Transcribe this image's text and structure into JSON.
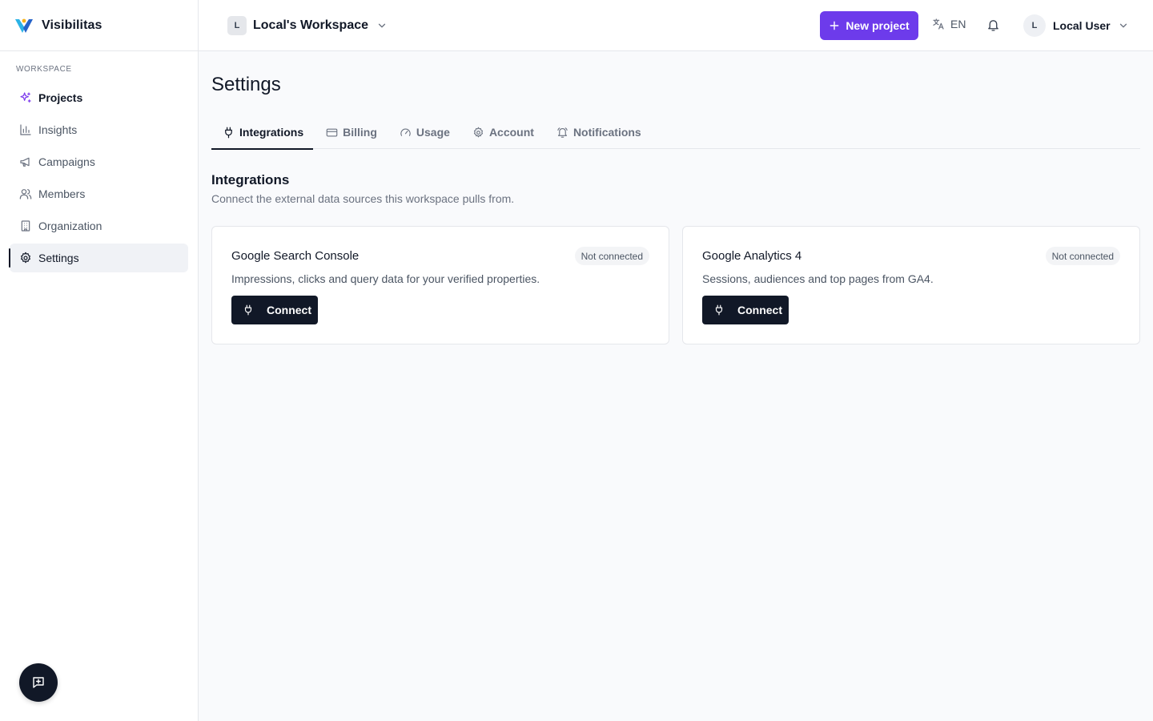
{
  "brand": {
    "name": "Visibilitas"
  },
  "sidebar": {
    "section_label": "WORKSPACE",
    "items": [
      {
        "label": "Projects",
        "icon": "sparkles-icon"
      },
      {
        "label": "Insights",
        "icon": "bar-chart-icon"
      },
      {
        "label": "Campaigns",
        "icon": "megaphone-icon"
      },
      {
        "label": "Members",
        "icon": "users-icon"
      },
      {
        "label": "Organization",
        "icon": "building-icon"
      },
      {
        "label": "Settings",
        "icon": "gear-icon",
        "active": true
      }
    ]
  },
  "topbar": {
    "workspace_initial": "L",
    "workspace_name": "Local's Workspace",
    "new_project_label": "New project",
    "language": "EN",
    "user_initial": "L",
    "user_name": "Local User"
  },
  "page": {
    "title": "Settings",
    "tabs": [
      {
        "label": "Integrations",
        "icon": "plug-icon",
        "active": true
      },
      {
        "label": "Billing",
        "icon": "credit-card-icon"
      },
      {
        "label": "Usage",
        "icon": "gauge-icon"
      },
      {
        "label": "Account",
        "icon": "gear-icon"
      },
      {
        "label": "Notifications",
        "icon": "bell-icon"
      }
    ],
    "section": {
      "title": "Integrations",
      "description": "Connect the external data sources this workspace pulls from."
    },
    "integrations": [
      {
        "name": "Google Search Console",
        "status": "Not connected",
        "description": "Impressions, clicks and query data for your verified properties.",
        "action_label": "Connect"
      },
      {
        "name": "Google Analytics 4",
        "status": "Not connected",
        "description": "Sessions, audiences and top pages from GA4.",
        "action_label": "Connect"
      }
    ]
  },
  "colors": {
    "accent": "#6d3beb",
    "primary_dark": "#111827",
    "background": "#f9fafc",
    "border": "#e5e7eb"
  }
}
